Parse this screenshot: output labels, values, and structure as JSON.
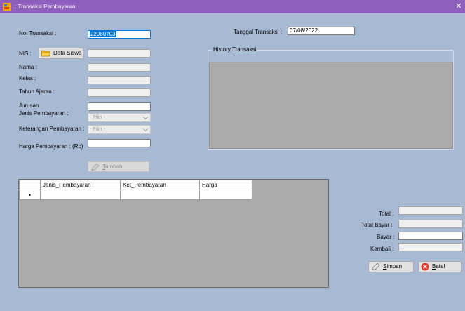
{
  "window": {
    "title": ".: Transaksi Pembayaran",
    "close_glyph": "✕"
  },
  "form": {
    "no_transaksi_label": "No. Transaksi :",
    "no_transaksi_value": "22080703",
    "tanggal_label": "Tanggal Transaksi :",
    "tanggal_value": "07/08/2022",
    "nis_label": "NIS :",
    "data_siswa_button": "Data Siswa",
    "nama_label": "Nama :",
    "kelas_label": "Kelas :",
    "tahun_ajaran_label": "Tahun Ajaran :",
    "jurusan_label": "Jurusan",
    "jenis_pembayaran_label": "Jenis Pembayaran :",
    "jenis_pembayaran_value": "- Pilih -",
    "keterangan_label": "Keterangan Pembayaran :",
    "keterangan_value": "- Pilih -",
    "harga_label": "Harga Pembayaran : (Rp)",
    "tambah_button_prefix": "T",
    "tambah_button_rest": "ambah"
  },
  "history": {
    "title": "History Transaksi"
  },
  "grid": {
    "columns": [
      "Jenis_Pembayaran",
      "Ket_Pembayaran",
      "Harga"
    ],
    "new_row_marker": "•"
  },
  "summary": {
    "total_label": "Total :",
    "total_bayar_label": "Total Bayar :",
    "bayar_label": "Bayar :",
    "kembali_label": "Kembali :",
    "simpan_prefix": "S",
    "simpan_rest": "impan",
    "batal_prefix": "B",
    "batal_rest": "atal"
  },
  "colors": {
    "titlebar": "#8e5fbd",
    "form_background": "#a7b9d3",
    "selection": "#0078d7"
  }
}
